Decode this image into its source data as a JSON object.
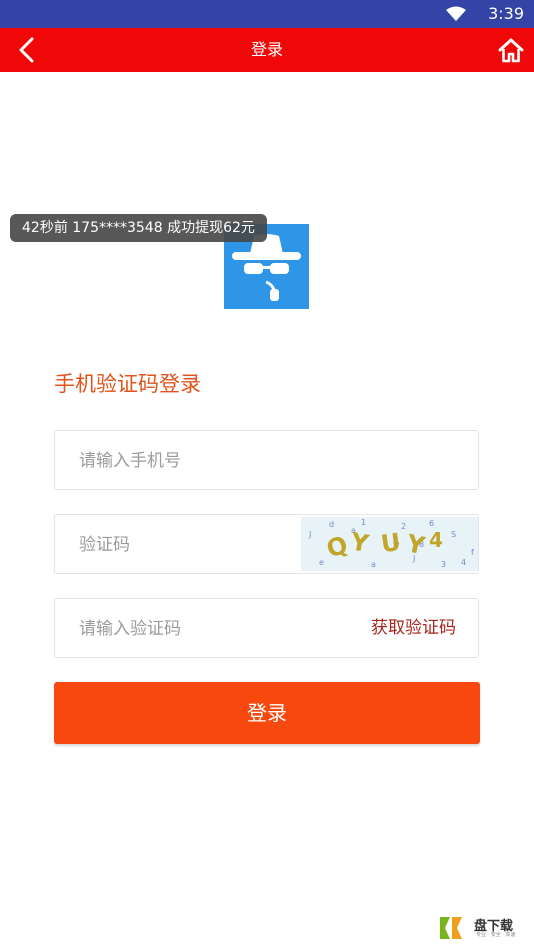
{
  "status_bar": {
    "time": "3:39"
  },
  "topbar": {
    "title": "登录"
  },
  "toast": {
    "text": "42秒前   175****3548   成功提现62元"
  },
  "form": {
    "section_title": "手机验证码登录",
    "phone_placeholder": "请输入手机号",
    "captcha_placeholder": "验证码",
    "captcha_text": "QY UY 4",
    "sms_code_placeholder": "请输入验证码",
    "get_code_label": "获取验证码",
    "login_label": "登录"
  },
  "watermark": {
    "brand": "盘下载",
    "sub": "专业 · 安全 · 高速"
  },
  "colors": {
    "status_bar": "#3344a6",
    "topbar": "#f00707",
    "accent": "#e1541c",
    "login_button": "#f7490f",
    "logo_bg": "#2f95e6"
  },
  "icons": [
    "wifi-icon",
    "back-arrow-icon",
    "home-icon",
    "spy-logo-icon"
  ]
}
